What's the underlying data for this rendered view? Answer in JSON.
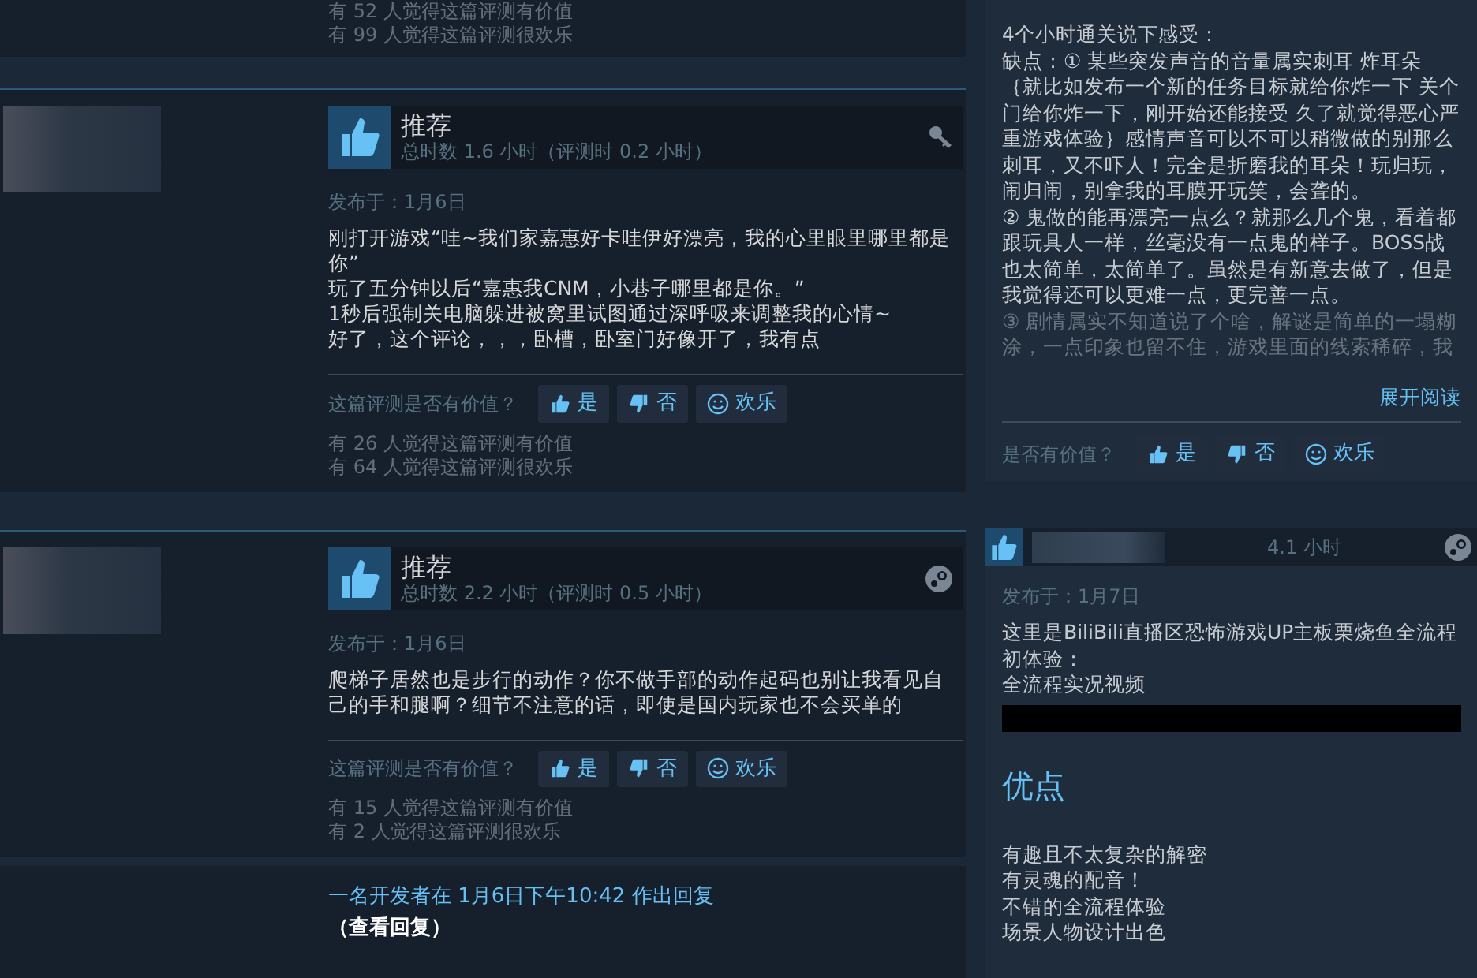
{
  "top_review_remnant": {
    "helpful_counts": [
      "有 52 人觉得这篇评测有价值",
      "有 99 人觉得这篇评测很欢乐"
    ]
  },
  "reviews": [
    {
      "recommendation": "推荐",
      "hours": "总时数 1.6 小时（评测时 0.2 小时）",
      "kind": "key",
      "posted": "发布于：1月6日",
      "paragraphs": [
        "刚打开游戏“哇~我们家嘉惠好卡哇伊好漂亮，我的心里眼里哪里都是你”",
        "玩了五分钟以后“嘉惠我CNM，小巷子哪里都是你。”",
        "1秒后强制关电脑躲进被窝里试图通过深呼吸来调整我的心情~",
        "好了，这个评论，，，卧槽，卧室门好像开了，我有点"
      ],
      "helpful_prompt": "这篇评测是否有价值？",
      "vote_buttons": [
        {
          "kind": "yes",
          "label": "是"
        },
        {
          "kind": "no",
          "label": "否"
        },
        {
          "kind": "funny",
          "label": "欢乐"
        }
      ],
      "helpful_counts": [
        "有 26 人觉得这篇评测有价值",
        "有 64 人觉得这篇评测很欢乐"
      ]
    },
    {
      "recommendation": "推荐",
      "hours": "总时数 2.2 小时（评测时 0.5 小时）",
      "kind": "steam",
      "posted": "发布于：1月6日",
      "paragraphs": [
        "爬梯子居然也是步行的动作？你不做手部的动作起码也别让我看见自己的手和腿啊？细节不注意的话，即使是国内玩家也不会买单的"
      ],
      "helpful_prompt": "这篇评测是否有价值？",
      "vote_buttons": [
        {
          "kind": "yes",
          "label": "是"
        },
        {
          "kind": "no",
          "label": "否"
        },
        {
          "kind": "funny",
          "label": "欢乐"
        }
      ],
      "helpful_counts": [
        "有 15 人觉得这篇评测有价值",
        "有 2 人觉得这篇评测很欢乐"
      ],
      "developer_response": {
        "text": "一名开发者在 1月6日下午10:42 作出回复",
        "link": "（查看回复）"
      }
    }
  ],
  "side_reviews": [
    {
      "paragraphs": [
        "4个小时通关说下感受：",
        "缺点：① 某些突发声音的音量属实刺耳 炸耳朵｛就比如发布一个新的任务目标就给你炸一下 关个门给你炸一下，刚开始还能接受 久了就觉得恶心严重游戏体验｝感情声音可以不可以稍微做的别那么刺耳，又不吓人！完全是折磨我的耳朵！玩归玩，闹归闹，别拿我的耳膜开玩笑，会聋的。",
        "② 鬼做的能再漂亮一点么？就那么几个鬼，看着都跟玩具人一样，丝毫没有一点鬼的样子。BOSS战也太简单，太简单了。虽然是有新意去做了，但是我觉得还可以更难一点，更完善一点。",
        "③ 剧情属实不知道说了个啥，解谜是简单的一塌糊涂，一点印象也留不住，游戏里面的线索稀碎，我"
      ],
      "expand_link": "展开阅读",
      "helpful_prompt": "是否有价值？",
      "vote_buttons": [
        {
          "kind": "yes",
          "label": "是"
        },
        {
          "kind": "no",
          "label": "否"
        },
        {
          "kind": "funny",
          "label": "欢乐"
        }
      ]
    },
    {
      "hours": "4.1 小时",
      "kind": "steam",
      "posted": "发布于：1月7日",
      "paragraphs": [
        "这里是BiliBili直播区恐怖游戏UP主板栗烧鱼全流程初体验：",
        "全流程实况视频"
      ],
      "video_embed": true,
      "heading": "优点",
      "list": [
        "有趣且不太复杂的解密",
        "有灵魂的配音！",
        "不错的全流程体验",
        "场景人物设计出色"
      ]
    }
  ]
}
